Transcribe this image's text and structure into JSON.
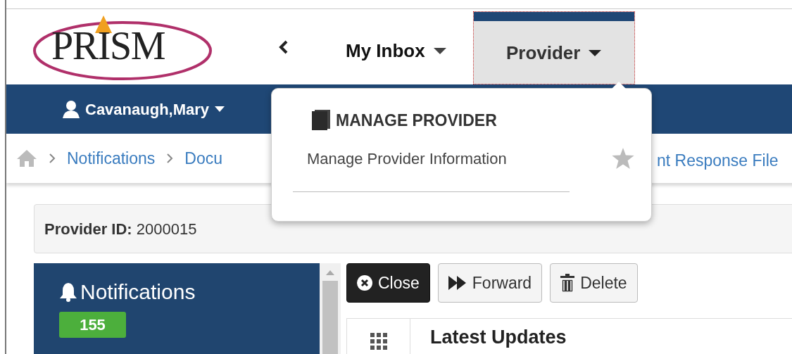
{
  "logo": {
    "text": "PRISM"
  },
  "nav_tabs": [
    {
      "label": "My Inbox",
      "selected": false
    },
    {
      "label": "Provider",
      "selected": true
    }
  ],
  "user_menu": {
    "label": "Cavanaugh,Mary"
  },
  "breadcrumb": [
    "Notifications",
    "Docu"
  ],
  "breadcrumb_tail": "nt Response File",
  "dropdown": {
    "heading": "MANAGE PROVIDER",
    "items": [
      "Manage Provider Information"
    ]
  },
  "provider_bar": {
    "label": "Provider ID:",
    "value": "2000015"
  },
  "sidebar": {
    "heading": "Notifications",
    "badge": "155"
  },
  "toolbar": [
    {
      "kind": "close",
      "label": "Close"
    },
    {
      "kind": "forward",
      "label": "Forward"
    },
    {
      "kind": "delete",
      "label": "Delete"
    }
  ],
  "panel": {
    "title": "Latest Updates"
  }
}
